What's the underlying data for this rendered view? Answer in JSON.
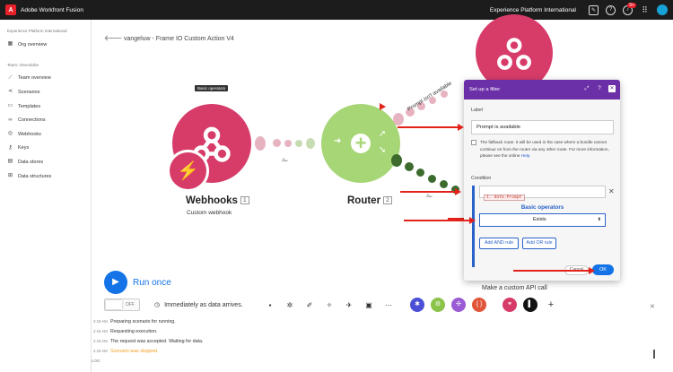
{
  "topbar": {
    "app_title": "Adobe Workfront Fusion",
    "org_name": "Experience Platform International",
    "notification_count": "9+",
    "logo_letter": "A"
  },
  "sidebar": {
    "org_label": "Experience Platform International",
    "org_overview": "Org overview",
    "team_label": "Team: OneAdobe",
    "items": [
      {
        "label": "Team overview",
        "icon": "chart-icon"
      },
      {
        "label": "Scenarios",
        "icon": "share-icon"
      },
      {
        "label": "Templates",
        "icon": "templates-icon"
      },
      {
        "label": "Connections",
        "icon": "link-icon"
      },
      {
        "label": "Webhooks",
        "icon": "globe-icon"
      },
      {
        "label": "Keys",
        "icon": "key-icon"
      },
      {
        "label": "Data stores",
        "icon": "database-icon"
      },
      {
        "label": "Data structures",
        "icon": "structure-icon"
      }
    ]
  },
  "canvas": {
    "scenario_title": "vangeluw - Frame IO Custom Action V4",
    "tooltip": "Basic operators",
    "webhooks": {
      "name": "Webhooks",
      "number": "1",
      "subtitle": "Custom webhook"
    },
    "router": {
      "name": "Router",
      "number": "2"
    },
    "route_label": "Prompt isn't available"
  },
  "filter_dialog": {
    "title": "Set up a filter",
    "label_caption": "Label",
    "label_value": "Prompt is available",
    "fallback_text": "The fallback route. It will be used in the case where a bundle cannot continue on from the router via any other route. For more information, please see the online",
    "help_link": "Help",
    "condition_caption": "Condition",
    "condition_chip": "1. data.Prompt",
    "operators_title": "Basic operators",
    "operator_value": "Exists",
    "add_and_rule": "Add AND rule",
    "add_or_rule": "Add OR rule",
    "cancel_label": "Cancel",
    "ok_label": "OK"
  },
  "bottom": {
    "run_once": "Run once",
    "toggle_state": "OFF",
    "schedule": "Immediately as data arrives.",
    "api_label": "Make a custom API call",
    "more_label": "+"
  },
  "log": [
    {
      "time": "2:18 AM",
      "message": "Preparing scenario for running.",
      "type": "info"
    },
    {
      "time": "2:18 AM",
      "message": "Requesting execution.",
      "type": "info"
    },
    {
      "time": "2:18 AM",
      "message": "The request was accepted. Waiting for data.",
      "type": "info"
    },
    {
      "time": "2:18 AM",
      "message": "Scenario was stopped.",
      "type": "warn"
    }
  ],
  "log_footer": "LOG",
  "colors": {
    "webhooks": "#d73c69",
    "router": "#a7d676",
    "dialog_header": "#6b2fa7",
    "accent": "#1473e6",
    "arrow": "#e3231b"
  }
}
